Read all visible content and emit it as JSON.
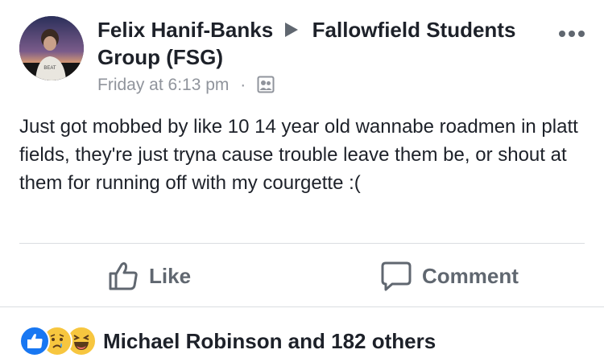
{
  "post": {
    "author": "Felix Hanif-Banks",
    "group": "Fallowfield Students Group (FSG)",
    "timestamp": "Friday at 6:13 pm",
    "separator": "·",
    "audience_icon": "group-icon",
    "more_icon": "more-icon",
    "text": "Just got mobbed by like 10 14 year old wannabe roadmen in platt fields, they're just tryna cause trouble leave them be, or shout at them for running off with my courgette :("
  },
  "actions": {
    "like_label": "Like",
    "comment_label": "Comment",
    "like_icon": "thumbs-up-icon",
    "comment_icon": "comment-bubble-icon"
  },
  "reactions": {
    "icons": [
      "like-reaction-icon",
      "sad-reaction-icon",
      "haha-reaction-icon"
    ],
    "summary": "Michael Robinson and 182 others"
  },
  "colors": {
    "text": "#1d2129",
    "meta": "#90949c",
    "action": "#606770",
    "like_blue": "#1877f2",
    "emoji_yellow": "#f7c63f",
    "divider": "#dadde1"
  }
}
